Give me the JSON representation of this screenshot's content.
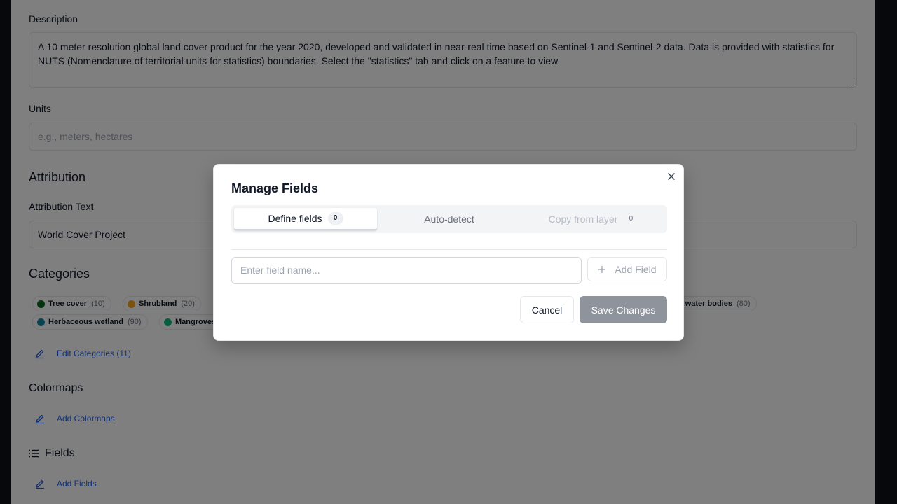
{
  "page": {
    "description_label": "Description",
    "description_text": "A 10 meter resolution global land cover product for the year 2020, developed and validated in near-real time based on Sentinel-1 and Sentinel-2 data.  Data is provided with statistics for NUTS (Nomenclature of territorial units for statistics) boundaries.  Select the \"statistics\" tab and click on a feature to view.",
    "units_label": "Units",
    "units_placeholder": "e.g., meters, hectares",
    "attribution_heading": "Attribution",
    "attribution_text_label": "Attribution Text",
    "attribution_text_value": "World Cover Project",
    "categories_heading": "Categories",
    "categories": [
      {
        "name": "Tree cover",
        "count": "(10)",
        "color": "#0b6b1c"
      },
      {
        "name": "Shrubland",
        "count": "(20)",
        "color": "#f5a623"
      },
      {
        "name": "t water bodies",
        "count": "(80)",
        "color": "#1f4fd6"
      },
      {
        "name": "Herbaceous wetland",
        "count": "(90)",
        "color": "#1289a7"
      },
      {
        "name": "Mangroves",
        "count": "",
        "color": "#10b981"
      }
    ],
    "edit_categories_label": "Edit Categories (11)",
    "colormaps_heading": "Colormaps",
    "add_colormaps_label": "Add Colormaps",
    "fields_heading": "Fields",
    "add_fields_label": "Add Fields"
  },
  "modal": {
    "title": "Manage Fields",
    "tabs": [
      {
        "label": "Define fields",
        "badge": "0",
        "state": "active"
      },
      {
        "label": "Auto-detect",
        "badge": "",
        "state": "normal"
      },
      {
        "label": "Copy from layer",
        "badge": "0",
        "state": "disabled"
      }
    ],
    "field_input_placeholder": "Enter field name...",
    "add_field_label": "Add Field",
    "cancel_label": "Cancel",
    "save_label": "Save Changes"
  },
  "colors": {
    "overlay": "rgba(0,0,0,0.5)",
    "link": "#2563eb",
    "save_button": "#8e939c"
  }
}
